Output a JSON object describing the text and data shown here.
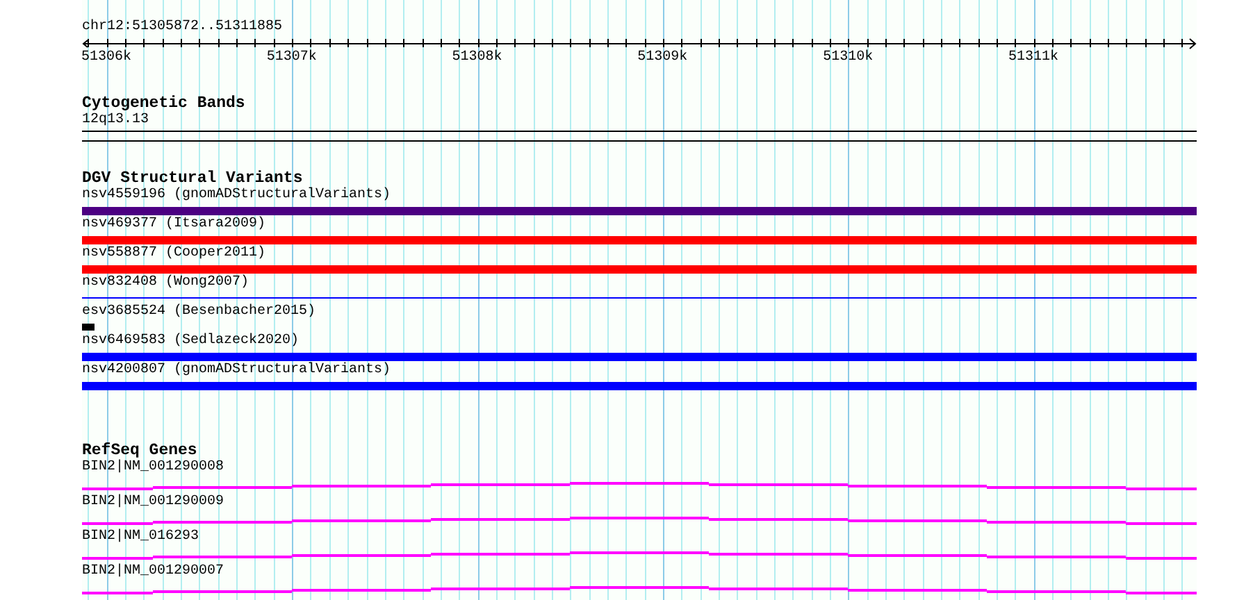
{
  "ruler": {
    "position": "chr12:51305872..51311885",
    "tick_labels": [
      "51306k",
      "51307k",
      "51308k",
      "51309k",
      "51310k",
      "51311k"
    ]
  },
  "cytogenetic_bands": {
    "title": "Cytogenetic Bands",
    "band": "12q13.13"
  },
  "dgv_structural_variants": {
    "title": "DGV Structural Variants",
    "variants": [
      {
        "label": "nsv4559196 (gnomADStructuralVariants)",
        "color": "#4b0082",
        "kind": "bar"
      },
      {
        "label": "nsv469377 (Itsara2009)",
        "color": "#ff0000",
        "kind": "bar"
      },
      {
        "label": "nsv558877 (Cooper2011)",
        "color": "#ff0000",
        "kind": "bar"
      },
      {
        "label": "nsv832408 (Wong2007)",
        "color": "#0000ff",
        "kind": "line"
      },
      {
        "label": "esv3685524 (Besenbacher2015)",
        "color": "#000000",
        "kind": "block"
      },
      {
        "label": "nsv6469583 (Sedlazeck2020)",
        "color": "#0000ff",
        "kind": "bar"
      },
      {
        "label": "nsv4200807 (gnomADStructuralVariants)",
        "color": "#0000ff",
        "kind": "bar"
      }
    ]
  },
  "refseq_genes": {
    "title": "RefSeq Genes",
    "genes": [
      {
        "label": "BIN2|NM_001290008"
      },
      {
        "label": "BIN2|NM_001290009"
      },
      {
        "label": "BIN2|NM_016293"
      },
      {
        "label": "BIN2|NM_001290007"
      }
    ]
  }
}
